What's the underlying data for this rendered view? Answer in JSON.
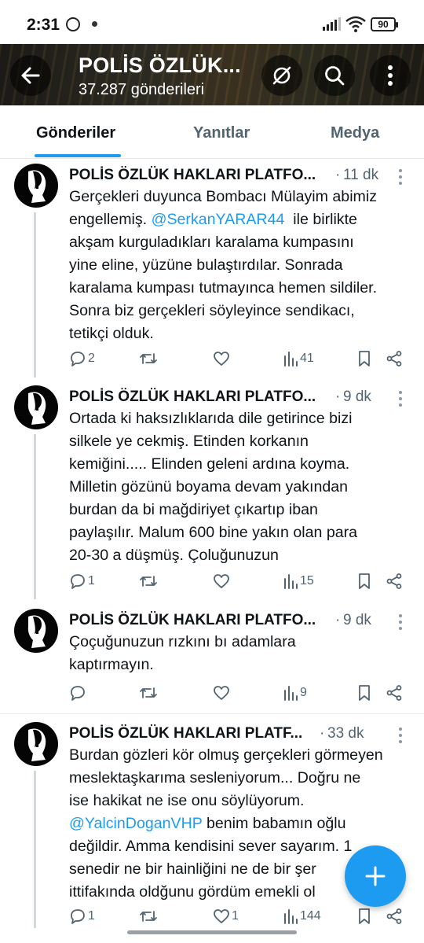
{
  "status_bar": {
    "time": "2:31",
    "battery": "90"
  },
  "header": {
    "title": "POLİS ÖZLÜK...",
    "subtitle": "37.287 gönderileri"
  },
  "tabs": [
    {
      "label": "Gönderiler",
      "active": true
    },
    {
      "label": "Yanıtlar",
      "active": false
    },
    {
      "label": "Medya",
      "active": false
    }
  ],
  "posts": [
    {
      "author": "POLİS ÖZLÜK HAKLARI PLATFO...",
      "time": "11 dk",
      "lines": [
        "Gerçekleri duyunca Bombacı Mülayim abimiz",
        "engellemiş.",
        "ile birlikte",
        "akşam kurguladıkları karalama kumpasını",
        "yine eline, yüzüne bulaştırdılar. Sonrada",
        "karalama kumpası tutmayınca hemen sildiler.",
        "Sonra biz gerçekleri söyleyince sendikacı,",
        "tetikçi olduk."
      ],
      "mention": "@SerkanYARAR44",
      "replies": "2",
      "retweets": "",
      "likes": "",
      "views": "41"
    },
    {
      "author": "POLİS ÖZLÜK HAKLARI PLATFO...",
      "time": "9 dk",
      "lines": [
        "Ortada ki haksızlıklarıda dile getirince bizi",
        "silkele ye cekmiş. Etinden korkanın",
        "kemiğini..... Elinden geleni ardına koyma.",
        "Milletin gözünü boyama devam yakından",
        "burdan da bi mağdiriyet çıkartıp iban",
        "paylaşılır. Malum 600 bine yakın olan para",
        "20-30 a düşmüş. Çoluğunuzun"
      ],
      "replies": "1",
      "retweets": "",
      "likes": "",
      "views": "15"
    },
    {
      "author": "POLİS ÖZLÜK HAKLARI PLATFO...",
      "time": "9 dk",
      "lines": [
        "Çoçuğunuzun rızkını bı adamlara",
        "kaptırmayın."
      ],
      "replies": "",
      "retweets": "",
      "likes": "",
      "views": "9"
    },
    {
      "author": "POLİS ÖZLÜK HAKLARI PLATF...",
      "time": "33 dk",
      "lines": [
        "Burdan gözleri kör olmuş gerçekleri görmeyen",
        "meslektaşkarıma sesleniyorum... Doğru ne",
        "ise hakikat ne ise onu söylüyorum.",
        "benim babamın oğlu",
        "değildir. Amma kendisini sever sayarım. 1",
        "senedir ne bir hainliğini ne de bir şer",
        "ittifakında oldğunu gördüm emekli ol"
      ],
      "mention": "@YalcinDoganVHP",
      "replies": "1",
      "retweets": "",
      "likes": "1",
      "views": "144"
    }
  ]
}
